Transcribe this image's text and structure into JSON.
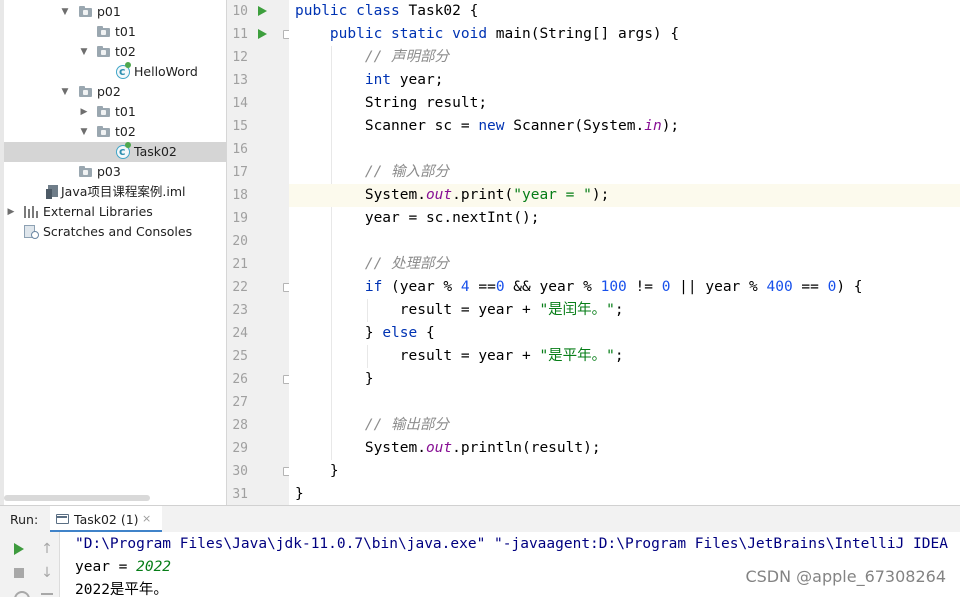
{
  "project_tree": {
    "items": [
      {
        "label": "p01"
      },
      {
        "label": "t01"
      },
      {
        "label": "t02"
      },
      {
        "label": "HelloWord"
      },
      {
        "label": "p02"
      },
      {
        "label": "t01"
      },
      {
        "label": "t02"
      },
      {
        "label": "Task02"
      },
      {
        "label": "p03"
      },
      {
        "label": "Java项目课程案例.iml"
      },
      {
        "label": "External Libraries"
      },
      {
        "label": "Scratches and Consoles"
      }
    ]
  },
  "editor": {
    "line_numbers": [
      "10",
      "11",
      "12",
      "13",
      "14",
      "15",
      "16",
      "17",
      "18",
      "19",
      "20",
      "21",
      "22",
      "23",
      "24",
      "25",
      "26",
      "27",
      "28",
      "29",
      "30",
      "31"
    ],
    "comments": {
      "declare": "// 声明部分",
      "input": "// 输入部分",
      "process": "// 处理部分",
      "output": "// 输出部分"
    },
    "strings": {
      "prompt": "\"year = \"",
      "leap": "\"是闰年。\"",
      "common": "\"是平年。\""
    },
    "numbers": {
      "n4": "4",
      "n0": "0",
      "n100": "100",
      "n400": "400"
    }
  },
  "run_panel": {
    "label": "Run:",
    "tab_label": "Task02 (1)",
    "tab_close": "×",
    "console_lines": {
      "command": "\"D:\\Program Files\\Java\\jdk-11.0.7\\bin\\java.exe\" \"-javaagent:D:\\Program Files\\JetBrains\\IntelliJ IDEA",
      "prompt": "year = ",
      "input_value": "2022",
      "result": "2022是平年。"
    }
  },
  "watermark": "CSDN @apple_67308264",
  "colors": {
    "keyword": "#0033b3",
    "string": "#067d17",
    "number": "#1750eb",
    "static_field": "#871094",
    "comment": "#8c8c8c",
    "run_green": "#3d9f3d",
    "tab_underline": "#4083c9"
  }
}
